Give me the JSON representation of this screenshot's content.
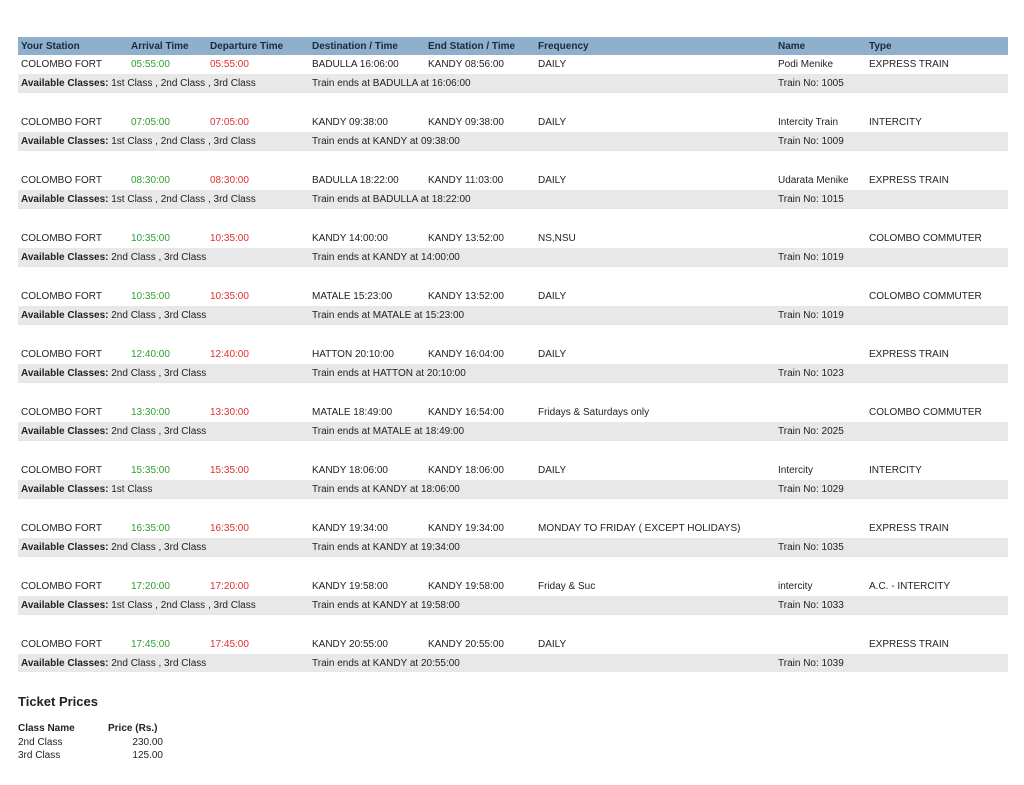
{
  "headers": {
    "station": "Your Station",
    "arrival": "Arrival Time",
    "departure": "Departure Time",
    "destination": "Destination / Time",
    "end_station": "End Station / Time",
    "frequency": "Frequency",
    "name": "Name",
    "type": "Type"
  },
  "classes_label": "Available Classes:",
  "trains": [
    {
      "station": "COLOMBO FORT",
      "arrival": "05:55:00",
      "departure": "05:55:00",
      "destination": "BADULLA  16:06:00",
      "end_station": "KANDY  08:56:00",
      "frequency": "DAILY",
      "name": "Podi Menike",
      "type": "EXPRESS TRAIN",
      "classes": "1st Class ,  2nd Class ,  3rd Class",
      "train_ends": "Train ends at BADULLA at 16:06:00",
      "train_no": "Train No:  1005"
    },
    {
      "station": "COLOMBO FORT",
      "arrival": "07:05:00",
      "departure": "07:05:00",
      "destination": "KANDY  09:38:00",
      "end_station": "KANDY  09:38:00",
      "frequency": "DAILY",
      "name": "Intercity Train",
      "type": "INTERCITY",
      "classes": "1st Class ,  2nd Class ,  3rd Class",
      "train_ends": "Train ends at KANDY at 09:38:00",
      "train_no": "Train No:  1009"
    },
    {
      "station": "COLOMBO FORT",
      "arrival": "08:30:00",
      "departure": "08:30:00",
      "destination": "BADULLA  18:22:00",
      "end_station": "KANDY  11:03:00",
      "frequency": "DAILY",
      "name": "Udarata Menike",
      "type": "EXPRESS TRAIN",
      "classes": "1st Class ,  2nd Class ,  3rd Class",
      "train_ends": "Train ends at BADULLA at 18:22:00",
      "train_no": "Train No:  1015"
    },
    {
      "station": "COLOMBO FORT",
      "arrival": "10:35:00",
      "departure": "10:35:00",
      "destination": "KANDY  14:00:00",
      "end_station": "KANDY  13:52:00",
      "frequency": "NS,NSU",
      "name": "",
      "type": "COLOMBO COMMUTER",
      "classes": "2nd Class ,  3rd Class",
      "train_ends": "Train ends at KANDY at 14:00:00",
      "train_no": "Train No:  1019"
    },
    {
      "station": "COLOMBO FORT",
      "arrival": "10:35:00",
      "departure": "10:35:00",
      "destination": "MATALE  15:23:00",
      "end_station": "KANDY  13:52:00",
      "frequency": "DAILY",
      "name": "",
      "type": "COLOMBO COMMUTER",
      "classes": "2nd Class ,  3rd Class",
      "train_ends": "Train ends at MATALE at 15:23:00",
      "train_no": "Train No:  1019"
    },
    {
      "station": "COLOMBO FORT",
      "arrival": "12:40:00",
      "departure": "12:40:00",
      "destination": "HATTON  20:10:00",
      "end_station": "KANDY  16:04:00",
      "frequency": "DAILY",
      "name": "",
      "type": "EXPRESS TRAIN",
      "classes": "2nd Class ,  3rd Class",
      "train_ends": "Train ends at HATTON at 20:10:00",
      "train_no": "Train No:  1023"
    },
    {
      "station": "COLOMBO FORT",
      "arrival": "13:30:00",
      "departure": "13:30:00",
      "destination": "MATALE  18:49:00",
      "end_station": "KANDY  16:54:00",
      "frequency": "Fridays & Saturdays only",
      "name": "",
      "type": "COLOMBO COMMUTER",
      "classes": "2nd Class ,  3rd Class",
      "train_ends": "Train ends at MATALE at 18:49:00",
      "train_no": "Train No:  2025"
    },
    {
      "station": "COLOMBO FORT",
      "arrival": "15:35:00",
      "departure": "15:35:00",
      "destination": "KANDY  18:06:00",
      "end_station": "KANDY  18:06:00",
      "frequency": "DAILY",
      "name": "Intercity",
      "type": "INTERCITY",
      "classes": "1st Class",
      "train_ends": "Train ends at KANDY at 18:06:00",
      "train_no": "Train No:  1029"
    },
    {
      "station": "COLOMBO FORT",
      "arrival": "16:35:00",
      "departure": "16:35:00",
      "destination": "KANDY  19:34:00",
      "end_station": "KANDY  19:34:00",
      "frequency": "MONDAY TO FRIDAY ( EXCEPT HOLIDAYS)",
      "name": "",
      "type": "EXPRESS TRAIN",
      "classes": "2nd Class ,  3rd Class",
      "train_ends": "Train ends at KANDY at 19:34:00",
      "train_no": "Train No:  1035"
    },
    {
      "station": "COLOMBO FORT",
      "arrival": "17:20:00",
      "departure": "17:20:00",
      "destination": "KANDY  19:58:00",
      "end_station": "KANDY  19:58:00",
      "frequency": "Friday & Suc",
      "name": "intercity",
      "type": "A.C. - INTERCITY",
      "classes": "1st Class ,  2nd Class ,  3rd Class",
      "train_ends": "Train ends at KANDY at 19:58:00",
      "train_no": "Train No:  1033"
    },
    {
      "station": "COLOMBO FORT",
      "arrival": "17:45:00",
      "departure": "17:45:00",
      "destination": "KANDY  20:55:00",
      "end_station": "KANDY  20:55:00",
      "frequency": "DAILY",
      "name": "",
      "type": "EXPRESS TRAIN",
      "classes": "2nd Class ,  3rd Class",
      "train_ends": "Train ends at KANDY at 20:55:00",
      "train_no": "Train No:  1039"
    }
  ],
  "ticket_prices": {
    "title": "Ticket Prices",
    "col_class": "Class Name",
    "col_price": "Price (Rs.)",
    "rows": [
      {
        "class": "2nd Class",
        "price": "230.00"
      },
      {
        "class": "3rd Class",
        "price": "125.00"
      }
    ]
  },
  "colors": {
    "header_bg": "#8fb0cd",
    "arrival": "#2f9e2f",
    "departure": "#e03030",
    "row2_bg": "#e8e8e8"
  }
}
